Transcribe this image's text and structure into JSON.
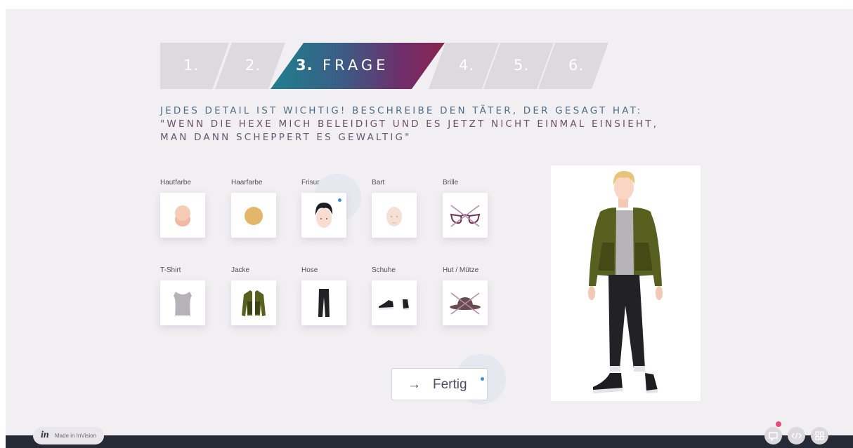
{
  "steps": [
    {
      "label": "1."
    },
    {
      "label": "2."
    },
    {
      "label": "3.",
      "word": "FRAGE",
      "active": true
    },
    {
      "label": "4."
    },
    {
      "label": "5."
    },
    {
      "label": "6."
    }
  ],
  "question": {
    "line1": "JEDES DETAIL IST WICHTIG! BESCHREIBE DEN TÄTER, DER GESAGT HAT:",
    "line2": "\"WENN DIE HEXE MICH BELEIDIGT UND ES JETZT NICHT EINMAL EINSIEHT,",
    "line3": "MAN DANN SCHEPPERT ES GEWALTIG\""
  },
  "options": [
    {
      "label": "Hautfarbe",
      "icon": "skin-color-icon"
    },
    {
      "label": "Haarfarbe",
      "icon": "hair-color-icon"
    },
    {
      "label": "Frisur",
      "icon": "hairstyle-icon"
    },
    {
      "label": "Bart",
      "icon": "beard-icon"
    },
    {
      "label": "Brille",
      "icon": "glasses-crossed-icon"
    },
    {
      "label": "T-Shirt",
      "icon": "tshirt-icon"
    },
    {
      "label": "Jacke",
      "icon": "jacket-icon"
    },
    {
      "label": "Hose",
      "icon": "trousers-icon"
    },
    {
      "label": "Schuhe",
      "icon": "shoes-icon"
    },
    {
      "label": "Hut / Mütze",
      "icon": "hat-crossed-icon"
    }
  ],
  "done_button": {
    "arrow": "→",
    "label": "Fertig"
  },
  "footer": {
    "made_in": "Made in InVision",
    "logo": "in"
  },
  "colors": {
    "background": "#f1eff2",
    "step_inactive": "#dcdadd",
    "accent_dot": "#3b8ee0",
    "notification": "#ea4b79",
    "bottom_bar": "#262a36"
  }
}
